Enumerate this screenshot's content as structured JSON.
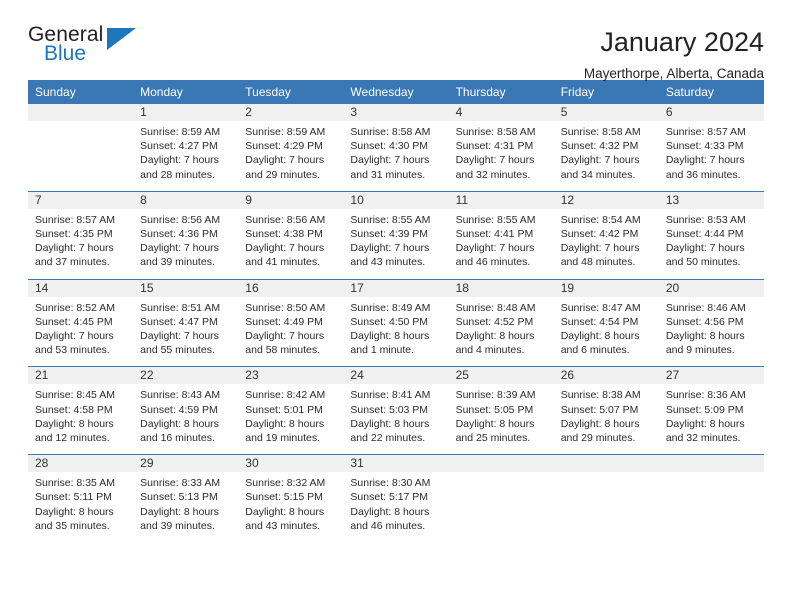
{
  "brand": {
    "name_part1": "General",
    "name_part2": "Blue",
    "triangle_color": "#1e76bd"
  },
  "header": {
    "title": "January 2024",
    "subtitle": "Mayerthorpe, Alberta, Canada"
  },
  "theme": {
    "header_bg": "#3a77b5",
    "daynum_bg": "#f0f0f0",
    "text": "#2b2b2b"
  },
  "weekdays": [
    "Sunday",
    "Monday",
    "Tuesday",
    "Wednesday",
    "Thursday",
    "Friday",
    "Saturday"
  ],
  "weeks": [
    [
      {
        "day": "",
        "sunrise": "",
        "sunset": "",
        "daylight1": "",
        "daylight2": "",
        "empty": true
      },
      {
        "day": "1",
        "sunrise": "Sunrise: 8:59 AM",
        "sunset": "Sunset: 4:27 PM",
        "daylight1": "Daylight: 7 hours",
        "daylight2": "and 28 minutes."
      },
      {
        "day": "2",
        "sunrise": "Sunrise: 8:59 AM",
        "sunset": "Sunset: 4:29 PM",
        "daylight1": "Daylight: 7 hours",
        "daylight2": "and 29 minutes."
      },
      {
        "day": "3",
        "sunrise": "Sunrise: 8:58 AM",
        "sunset": "Sunset: 4:30 PM",
        "daylight1": "Daylight: 7 hours",
        "daylight2": "and 31 minutes."
      },
      {
        "day": "4",
        "sunrise": "Sunrise: 8:58 AM",
        "sunset": "Sunset: 4:31 PM",
        "daylight1": "Daylight: 7 hours",
        "daylight2": "and 32 minutes."
      },
      {
        "day": "5",
        "sunrise": "Sunrise: 8:58 AM",
        "sunset": "Sunset: 4:32 PM",
        "daylight1": "Daylight: 7 hours",
        "daylight2": "and 34 minutes."
      },
      {
        "day": "6",
        "sunrise": "Sunrise: 8:57 AM",
        "sunset": "Sunset: 4:33 PM",
        "daylight1": "Daylight: 7 hours",
        "daylight2": "and 36 minutes."
      }
    ],
    [
      {
        "day": "7",
        "sunrise": "Sunrise: 8:57 AM",
        "sunset": "Sunset: 4:35 PM",
        "daylight1": "Daylight: 7 hours",
        "daylight2": "and 37 minutes."
      },
      {
        "day": "8",
        "sunrise": "Sunrise: 8:56 AM",
        "sunset": "Sunset: 4:36 PM",
        "daylight1": "Daylight: 7 hours",
        "daylight2": "and 39 minutes."
      },
      {
        "day": "9",
        "sunrise": "Sunrise: 8:56 AM",
        "sunset": "Sunset: 4:38 PM",
        "daylight1": "Daylight: 7 hours",
        "daylight2": "and 41 minutes."
      },
      {
        "day": "10",
        "sunrise": "Sunrise: 8:55 AM",
        "sunset": "Sunset: 4:39 PM",
        "daylight1": "Daylight: 7 hours",
        "daylight2": "and 43 minutes."
      },
      {
        "day": "11",
        "sunrise": "Sunrise: 8:55 AM",
        "sunset": "Sunset: 4:41 PM",
        "daylight1": "Daylight: 7 hours",
        "daylight2": "and 46 minutes."
      },
      {
        "day": "12",
        "sunrise": "Sunrise: 8:54 AM",
        "sunset": "Sunset: 4:42 PM",
        "daylight1": "Daylight: 7 hours",
        "daylight2": "and 48 minutes."
      },
      {
        "day": "13",
        "sunrise": "Sunrise: 8:53 AM",
        "sunset": "Sunset: 4:44 PM",
        "daylight1": "Daylight: 7 hours",
        "daylight2": "and 50 minutes."
      }
    ],
    [
      {
        "day": "14",
        "sunrise": "Sunrise: 8:52 AM",
        "sunset": "Sunset: 4:45 PM",
        "daylight1": "Daylight: 7 hours",
        "daylight2": "and 53 minutes."
      },
      {
        "day": "15",
        "sunrise": "Sunrise: 8:51 AM",
        "sunset": "Sunset: 4:47 PM",
        "daylight1": "Daylight: 7 hours",
        "daylight2": "and 55 minutes."
      },
      {
        "day": "16",
        "sunrise": "Sunrise: 8:50 AM",
        "sunset": "Sunset: 4:49 PM",
        "daylight1": "Daylight: 7 hours",
        "daylight2": "and 58 minutes."
      },
      {
        "day": "17",
        "sunrise": "Sunrise: 8:49 AM",
        "sunset": "Sunset: 4:50 PM",
        "daylight1": "Daylight: 8 hours",
        "daylight2": "and 1 minute."
      },
      {
        "day": "18",
        "sunrise": "Sunrise: 8:48 AM",
        "sunset": "Sunset: 4:52 PM",
        "daylight1": "Daylight: 8 hours",
        "daylight2": "and 4 minutes."
      },
      {
        "day": "19",
        "sunrise": "Sunrise: 8:47 AM",
        "sunset": "Sunset: 4:54 PM",
        "daylight1": "Daylight: 8 hours",
        "daylight2": "and 6 minutes."
      },
      {
        "day": "20",
        "sunrise": "Sunrise: 8:46 AM",
        "sunset": "Sunset: 4:56 PM",
        "daylight1": "Daylight: 8 hours",
        "daylight2": "and 9 minutes."
      }
    ],
    [
      {
        "day": "21",
        "sunrise": "Sunrise: 8:45 AM",
        "sunset": "Sunset: 4:58 PM",
        "daylight1": "Daylight: 8 hours",
        "daylight2": "and 12 minutes."
      },
      {
        "day": "22",
        "sunrise": "Sunrise: 8:43 AM",
        "sunset": "Sunset: 4:59 PM",
        "daylight1": "Daylight: 8 hours",
        "daylight2": "and 16 minutes."
      },
      {
        "day": "23",
        "sunrise": "Sunrise: 8:42 AM",
        "sunset": "Sunset: 5:01 PM",
        "daylight1": "Daylight: 8 hours",
        "daylight2": "and 19 minutes."
      },
      {
        "day": "24",
        "sunrise": "Sunrise: 8:41 AM",
        "sunset": "Sunset: 5:03 PM",
        "daylight1": "Daylight: 8 hours",
        "daylight2": "and 22 minutes."
      },
      {
        "day": "25",
        "sunrise": "Sunrise: 8:39 AM",
        "sunset": "Sunset: 5:05 PM",
        "daylight1": "Daylight: 8 hours",
        "daylight2": "and 25 minutes."
      },
      {
        "day": "26",
        "sunrise": "Sunrise: 8:38 AM",
        "sunset": "Sunset: 5:07 PM",
        "daylight1": "Daylight: 8 hours",
        "daylight2": "and 29 minutes."
      },
      {
        "day": "27",
        "sunrise": "Sunrise: 8:36 AM",
        "sunset": "Sunset: 5:09 PM",
        "daylight1": "Daylight: 8 hours",
        "daylight2": "and 32 minutes."
      }
    ],
    [
      {
        "day": "28",
        "sunrise": "Sunrise: 8:35 AM",
        "sunset": "Sunset: 5:11 PM",
        "daylight1": "Daylight: 8 hours",
        "daylight2": "and 35 minutes."
      },
      {
        "day": "29",
        "sunrise": "Sunrise: 8:33 AM",
        "sunset": "Sunset: 5:13 PM",
        "daylight1": "Daylight: 8 hours",
        "daylight2": "and 39 minutes."
      },
      {
        "day": "30",
        "sunrise": "Sunrise: 8:32 AM",
        "sunset": "Sunset: 5:15 PM",
        "daylight1": "Daylight: 8 hours",
        "daylight2": "and 43 minutes."
      },
      {
        "day": "31",
        "sunrise": "Sunrise: 8:30 AM",
        "sunset": "Sunset: 5:17 PM",
        "daylight1": "Daylight: 8 hours",
        "daylight2": "and 46 minutes."
      },
      {
        "day": "",
        "sunrise": "",
        "sunset": "",
        "daylight1": "",
        "daylight2": "",
        "empty": true
      },
      {
        "day": "",
        "sunrise": "",
        "sunset": "",
        "daylight1": "",
        "daylight2": "",
        "empty": true
      },
      {
        "day": "",
        "sunrise": "",
        "sunset": "",
        "daylight1": "",
        "daylight2": "",
        "empty": true
      }
    ]
  ]
}
